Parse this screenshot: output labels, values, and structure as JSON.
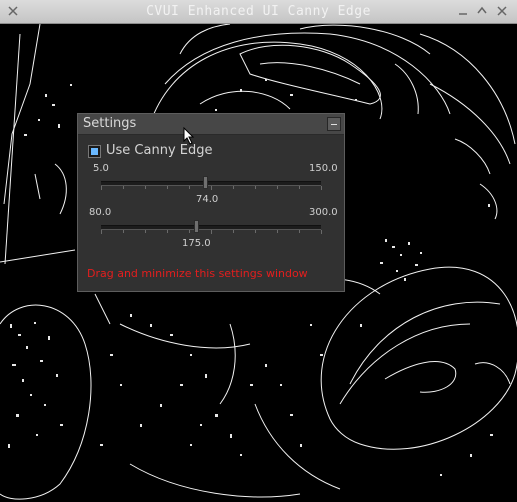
{
  "window": {
    "title": "CVUI Enhanced UI Canny Edge"
  },
  "settings": {
    "title": "Settings",
    "checkbox_label": "Use Canny Edge",
    "checkbox_checked": true,
    "accent_color": "#6ab8ff",
    "slider1": {
      "min_label": "5.0",
      "max_label": "150.0",
      "value_label": "74.0",
      "min": 5,
      "max": 150,
      "value": 74
    },
    "slider2": {
      "min_label": "80.0",
      "max_label": "300.0",
      "value_label": "175.0",
      "min": 80,
      "max": 300,
      "value": 175
    },
    "message": "Drag and minimize this settings window",
    "message_color": "#e31e1e"
  }
}
